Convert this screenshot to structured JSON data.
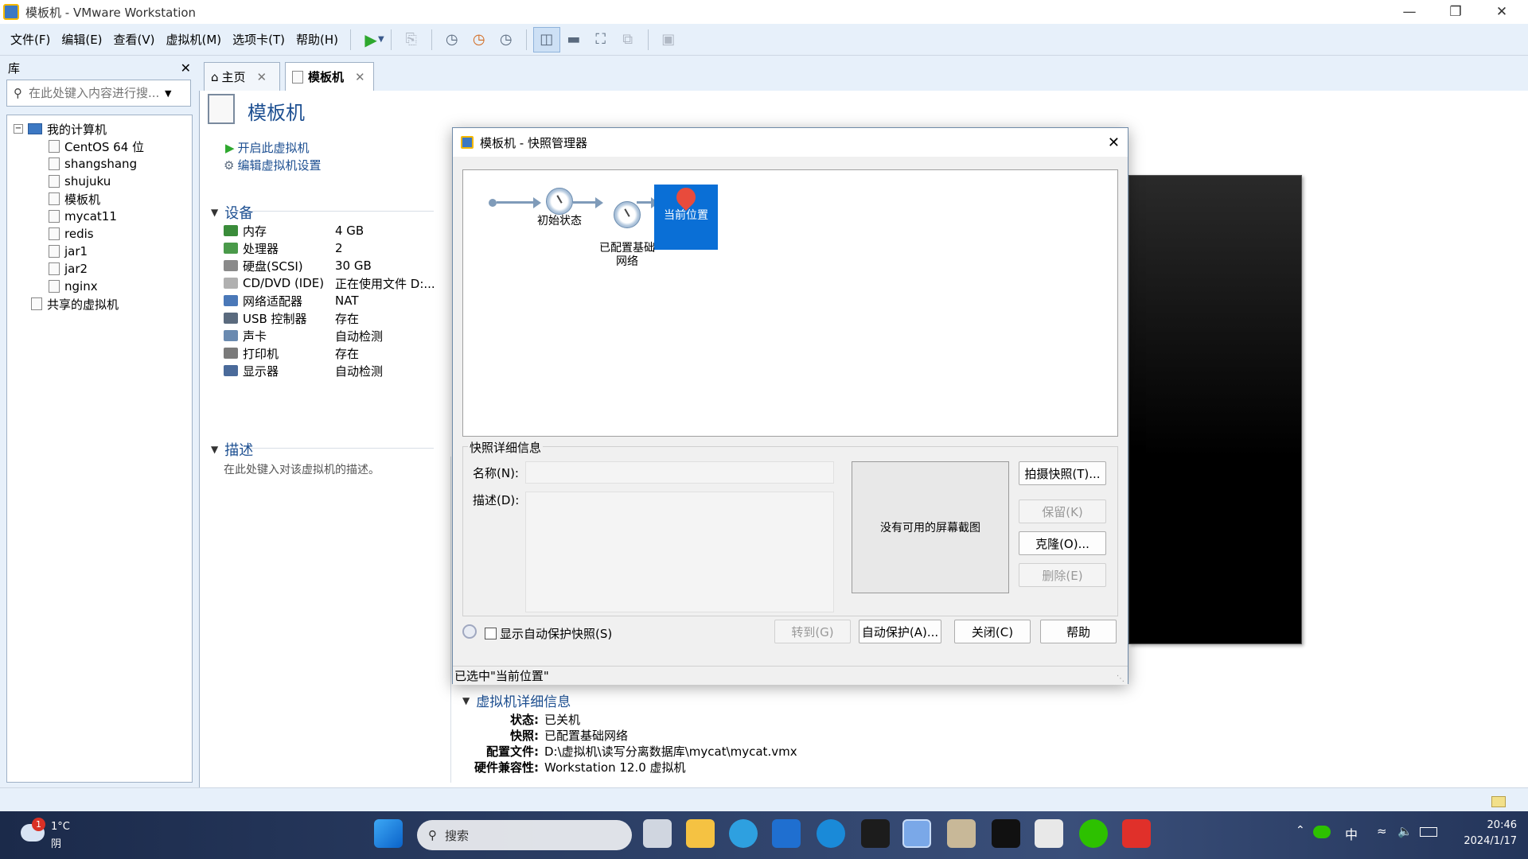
{
  "window": {
    "title": "模板机 - VMware Workstation"
  },
  "menu": [
    "文件(F)",
    "编辑(E)",
    "查看(V)",
    "虚拟机(M)",
    "选项卡(T)",
    "帮助(H)"
  ],
  "library": {
    "title": "库",
    "search_placeholder": "在此处键入内容进行搜...",
    "tree": {
      "root": "我的计算机",
      "vms": [
        "CentOS 64 位",
        "shangshang",
        "shujuku",
        "模板机",
        "mycat11",
        "redis",
        "jar1",
        "jar2",
        "nginx"
      ],
      "shared": "共享的虚拟机"
    }
  },
  "tabs": [
    {
      "label": "主页"
    },
    {
      "label": "模板机"
    }
  ],
  "vm": {
    "name": "模板机",
    "actions": {
      "start": "开启此虚拟机",
      "edit": "编辑虚拟机设置"
    },
    "devices_heading": "设备",
    "devices": [
      {
        "name": "内存",
        "value": "4 GB",
        "icon": "memory-icon",
        "color": "#3a8c3a"
      },
      {
        "name": "处理器",
        "value": "2",
        "icon": "cpu-icon",
        "color": "#4a9a4a"
      },
      {
        "name": "硬盘(SCSI)",
        "value": "30 GB",
        "icon": "harddisk-icon",
        "color": "#8a8a8a"
      },
      {
        "name": "CD/DVD (IDE)",
        "value": "正在使用文件 D:...",
        "icon": "cd-icon",
        "color": "#b0b0b0"
      },
      {
        "name": "网络适配器",
        "value": "NAT",
        "icon": "network-icon",
        "color": "#4a78b8"
      },
      {
        "name": "USB 控制器",
        "value": "存在",
        "icon": "usb-icon",
        "color": "#5a6a7e"
      },
      {
        "name": "声卡",
        "value": "自动检测",
        "icon": "sound-icon",
        "color": "#6a8ab0"
      },
      {
        "name": "打印机",
        "value": "存在",
        "icon": "printer-icon",
        "color": "#7a7a7a"
      },
      {
        "name": "显示器",
        "value": "自动检测",
        "icon": "monitor-icon",
        "color": "#4a6a9a"
      }
    ],
    "description_heading": "描述",
    "description_placeholder": "在此处键入对该虚拟机的描述。",
    "details_heading": "虚拟机详细信息",
    "details": [
      {
        "label": "状态:",
        "value": "已关机"
      },
      {
        "label": "快照:",
        "value": "已配置基础网络"
      },
      {
        "label": "配置文件:",
        "value": "D:\\虚拟机\\读写分离数据库\\mycat\\mycat.vmx"
      },
      {
        "label": "硬件兼容性:",
        "value": "Workstation 12.0 虚拟机"
      }
    ]
  },
  "dialog": {
    "title": "模板机 - 快照管理器",
    "nodes": [
      {
        "label": "初始状态"
      },
      {
        "label": "已配置基础\n网络"
      },
      {
        "label": "当前位置"
      }
    ],
    "details_group": "快照详细信息",
    "name_label": "名称(N):",
    "desc_label": "描述(D):",
    "no_screenshot": "没有可用的屏幕截图",
    "buttons": {
      "take": "拍摄快照(T)...",
      "keep": "保留(K)",
      "clone": "克隆(O)...",
      "delete": "删除(E)",
      "goto": "转到(G)",
      "autoprotect": "自动保护(A)...",
      "close": "关闭(C)",
      "help": "帮助"
    },
    "show_autoprotect": "显示自动保护快照(S)",
    "status": "已选中\"当前位置\""
  },
  "taskbar": {
    "weather_temp": "1°C",
    "weather_cond": "阴",
    "weather_badge": "1",
    "search": "搜索",
    "ime": "中",
    "time": "20:46",
    "date": "2024/1/17"
  }
}
